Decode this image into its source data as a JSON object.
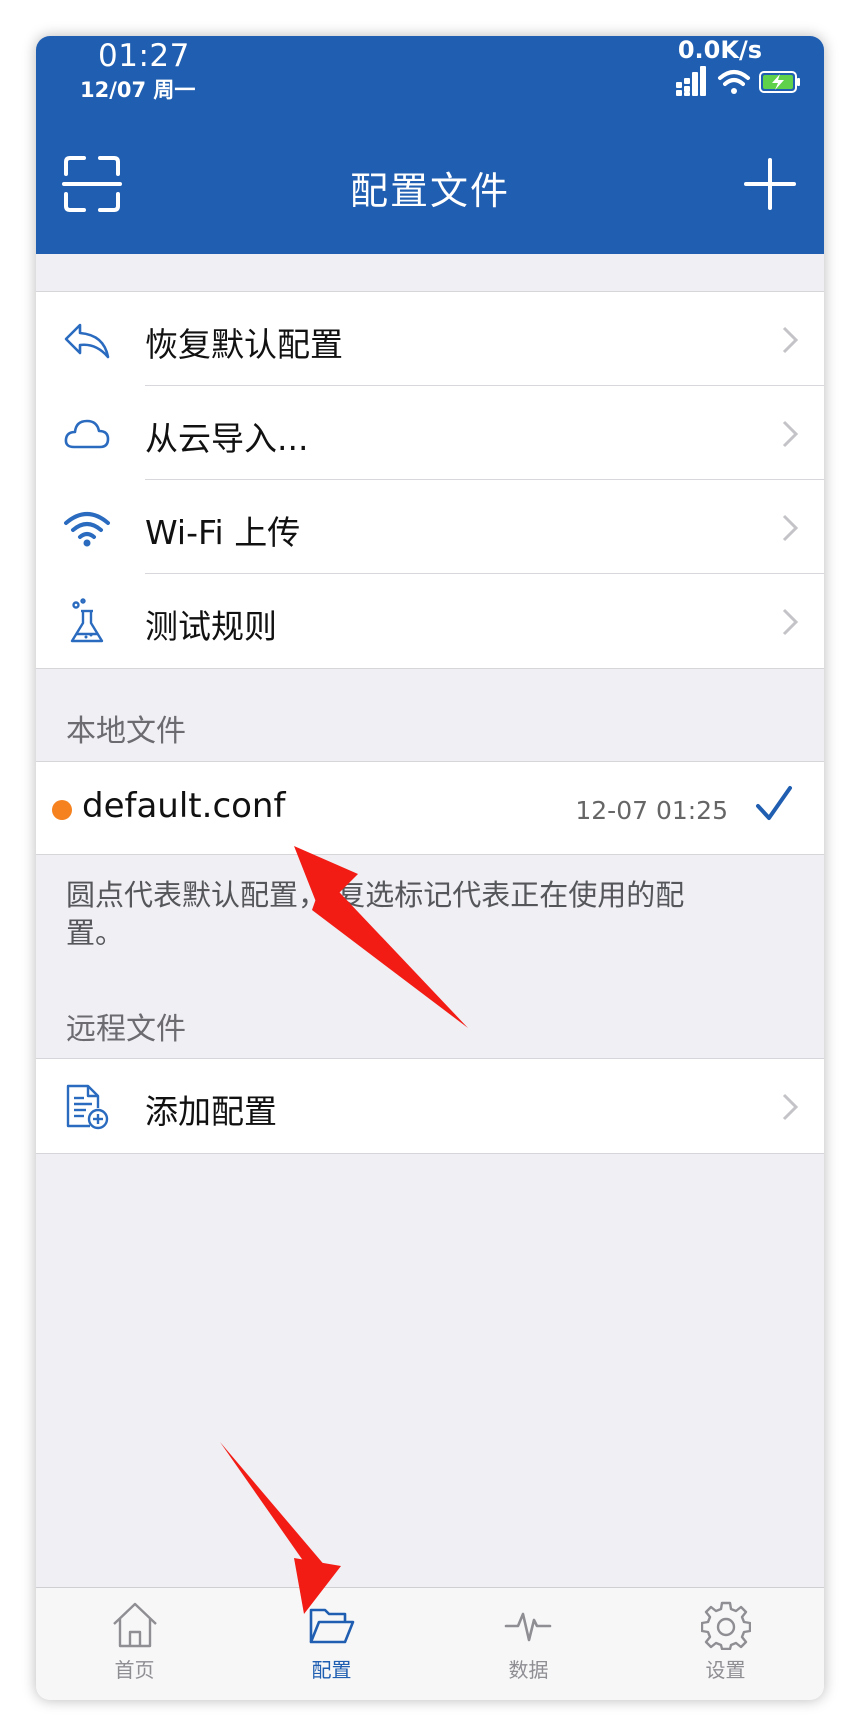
{
  "status_bar": {
    "time": "01:27",
    "date": "12/07 周一",
    "net_speed": "0.0K/s",
    "icons": [
      "signal-icon",
      "wifi-icon",
      "battery-charging-icon"
    ]
  },
  "nav": {
    "title": "配置文件",
    "left_icon": "scan-icon",
    "right_icon": "plus-icon"
  },
  "actions": [
    {
      "label": "恢复默认配置",
      "icon": "undo-icon"
    },
    {
      "label": "从云导入...",
      "icon": "cloud-icon"
    },
    {
      "label": "Wi-Fi 上传",
      "icon": "wifi-icon"
    },
    {
      "label": "测试规则",
      "icon": "flask-icon"
    }
  ],
  "local": {
    "header": "本地文件",
    "files": [
      {
        "name": "default.conf",
        "date": "12-07 01:25",
        "is_default": true,
        "in_use": true
      }
    ],
    "footnote": "圆点代表默认配置， 复选标记代表正在使用的配置。"
  },
  "remote": {
    "header": "远程文件",
    "add_label": "添加配置",
    "add_icon": "document-add-icon"
  },
  "tabs": [
    {
      "label": "首页",
      "icon": "home-icon",
      "active": false
    },
    {
      "label": "配置",
      "icon": "folder-icon",
      "active": true
    },
    {
      "label": "数据",
      "icon": "pulse-icon",
      "active": false
    },
    {
      "label": "设置",
      "icon": "gear-icon",
      "active": false
    }
  ],
  "colors": {
    "brand": "#1f5eb0",
    "default_dot": "#f5821f",
    "tab_inactive": "#8e8e93",
    "annotation_arrow": "#f21c14"
  }
}
